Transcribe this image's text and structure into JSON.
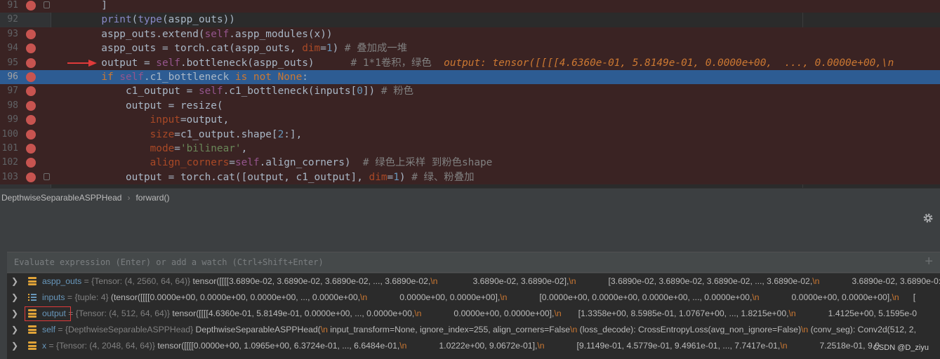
{
  "editor": {
    "lines": [
      {
        "n": "91"
      },
      {
        "n": "92"
      },
      {
        "n": "93"
      },
      {
        "n": "94"
      },
      {
        "n": "95"
      },
      {
        "n": "96"
      },
      {
        "n": "97"
      },
      {
        "n": "98"
      },
      {
        "n": "99"
      },
      {
        "n": "100"
      },
      {
        "n": "101"
      },
      {
        "n": "102"
      },
      {
        "n": "103"
      }
    ],
    "comments": {
      "l94": "# 叠加成一堆",
      "l95": "# 1*1卷积，绿色",
      "l97": "# 粉色",
      "l102": "# 绿色上采样 到粉色shape",
      "l103": "# 绿、粉叠加"
    },
    "inline_debug": {
      "label": "output:",
      "value": "tensor([[[[4.6360e-01, 5.8149e-01, 0.0000e+00,  ..., 0.0000e+00,\\n"
    }
  },
  "breadcrumb": {
    "class_name": "DepthwiseSeparableASPPHead",
    "method_name": "forward()"
  },
  "debug": {
    "eval_placeholder": "Evaluate expression (Enter) or add a watch (Ctrl+Shift+Enter)",
    "variables": [
      {
        "name": "aspp_outs",
        "type": "{Tensor: (4, 2560, 64, 64)}",
        "parts": [
          "tensor([[[[3.6890e-02, 3.6890e-02, 3.6890e-02,  ..., 3.6890e-02,",
          "3.6890e-02, 3.6890e-02],",
          "[3.6890e-02, 3.6890e-02, 3.6890e-02,  ..., 3.6890e-02,",
          "3.6890e-02, 3.6890e-0:"
        ]
      },
      {
        "name": "inputs",
        "type": "{tuple: 4}",
        "parts": [
          "(tensor([[[[0.0000e+00, 0.0000e+00, 0.0000e+00,  ..., 0.0000e+00,",
          "0.0000e+00, 0.0000e+00],",
          "[0.0000e+00, 0.0000e+00, 0.0000e+00,  ..., 0.0000e+00,",
          "0.0000e+00, 0.0000e+00],",
          "["
        ]
      },
      {
        "name": "output",
        "type": "{Tensor: (4, 512, 64, 64)}",
        "parts": [
          "tensor([[[[4.6360e-01, 5.8149e-01, 0.0000e+00,  ..., 0.0000e+00,",
          "0.0000e+00, 0.0000e+00],",
          "[1.3358e+00, 8.5985e-01, 1.0767e+00,  ..., 1.8215e+00,",
          "1.4125e+00, 5.1595e-0"
        ]
      },
      {
        "name": "self",
        "type": "{DepthwiseSeparableASPPHead}",
        "parts": [
          "DepthwiseSeparableASPPHead(",
          "input_transform=None, ignore_index=255, align_corners=False",
          "(loss_decode): CrossEntropyLoss(avg_non_ignore=False)",
          "(conv_seg): Conv2d(512, 2,"
        ]
      },
      {
        "name": "x",
        "type": "{Tensor: (4, 2048, 64, 64)}",
        "parts": [
          "tensor([[[[0.0000e+00, 1.0965e+00, 6.3724e-01,  ..., 6.6484e-01,",
          "1.0222e+00, 9.0672e-01],",
          "[9.1149e-01, 4.5779e-01, 9.4961e-01,  ..., 7.7417e-01,",
          "7.2518e-01, 9.0"
        ]
      }
    ],
    "newline_token": "\\n",
    "equals": "="
  },
  "watermark": "CSDN @D_ziyu",
  "colors": {
    "breakpoint": "#c75450",
    "current_line": "#2d5c93",
    "highlight_box": "#e03a3a"
  }
}
